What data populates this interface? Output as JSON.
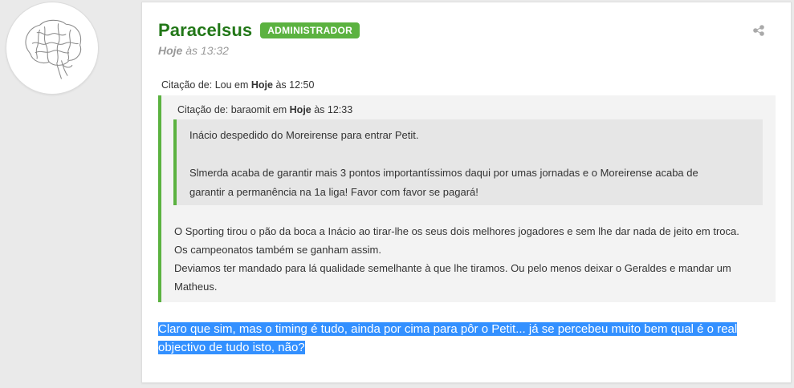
{
  "author": {
    "name": "Paracelsus",
    "badge": "ADMINISTRADOR",
    "time_day": "Hoje",
    "time_rest": " às 13:32"
  },
  "quote_outer": {
    "cite_prefix": "Citação de: Lou em ",
    "cite_day": "Hoje",
    "cite_time": " às 12:50",
    "body": [
      "O Sporting tirou o pão da boca a Inácio ao tirar-lhe os seus dois melhores jogadores e sem lhe dar nada de jeito em troca.",
      "Os campeonatos também se ganham assim.",
      "Deviamos ter mandado para lá qualidade semelhante à que lhe tiramos. Ou pelo menos deixar o Geraldes e mandar um",
      "Matheus."
    ]
  },
  "quote_inner": {
    "cite_prefix": "Citação de: baraomit em ",
    "cite_day": "Hoje",
    "cite_time": " às 12:33",
    "line1": "Inácio despedido do Moreirense para entrar Petit.",
    "line2": "Slmerda acaba de garantir mais 3 pontos importantíssimos daqui por umas jornadas e o Moreirense acaba de",
    "line3": "garantir a permanência na 1a liga! Favor com favor se pagará!"
  },
  "reply": {
    "line1": "Claro que sim, mas o timing é tudo, ainda por cima para pôr o Petit... já se percebeu muito bem qual é o real",
    "line2": "objectivo de tudo isto, não?"
  },
  "icons": {
    "share": "share-icon",
    "avatar": "brain-avatar"
  },
  "colors": {
    "username": "#227718",
    "badge": "#5bb240",
    "quote_border": "#5bb240",
    "selection": "#3390ff"
  }
}
